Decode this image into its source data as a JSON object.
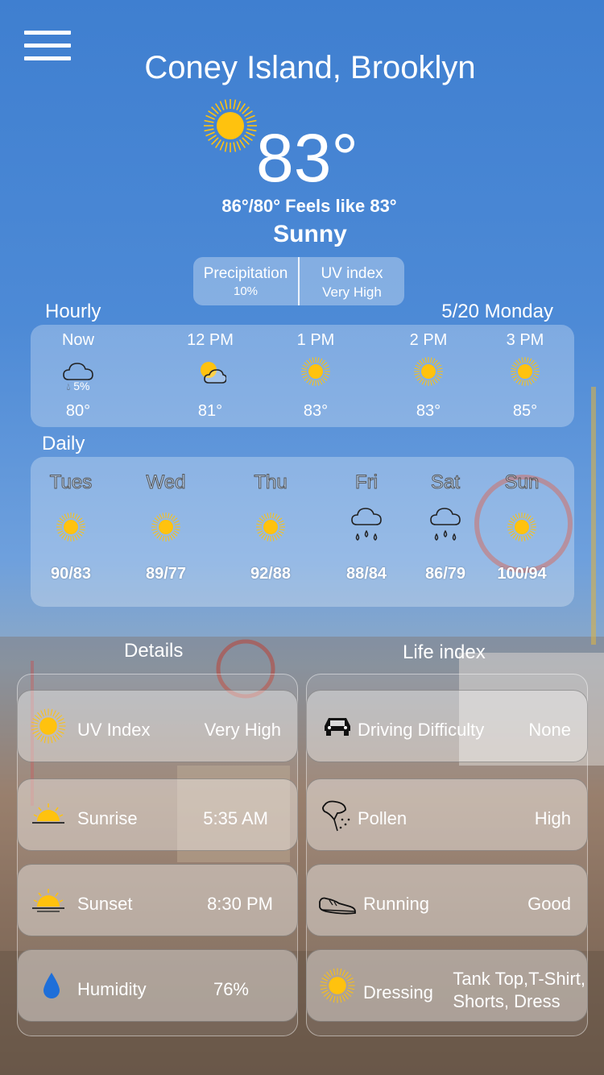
{
  "header": {
    "city": "Coney Island, Brooklyn",
    "temperature": "83°",
    "hi_lo_feels": "86°/80° Feels like 83°",
    "condition": "Sunny",
    "weather_icon": "sun-icon"
  },
  "stats": {
    "precipitation_label": "Precipitation",
    "precipitation_value": "10%",
    "uv_label": "UV index",
    "uv_value": "Very High"
  },
  "hourly": {
    "label": "Hourly",
    "date": "5/20 Monday",
    "items": [
      {
        "time": "Now",
        "icon": "cloud-icon",
        "pop": "5%",
        "temp": "80°"
      },
      {
        "time": "12 PM",
        "icon": "partly-cloudy-icon",
        "pop": "",
        "temp": "81°"
      },
      {
        "time": "1 PM",
        "icon": "sun-icon",
        "pop": "",
        "temp": "83°"
      },
      {
        "time": "2 PM",
        "icon": "sun-icon",
        "pop": "",
        "temp": "83°"
      },
      {
        "time": "3 PM",
        "icon": "sun-icon",
        "pop": "",
        "temp": "85°"
      }
    ]
  },
  "daily": {
    "label": "Daily",
    "items": [
      {
        "day": "Tues",
        "icon": "sun-icon",
        "temps": "90/83"
      },
      {
        "day": "Wed",
        "icon": "sun-icon",
        "temps": "89/77"
      },
      {
        "day": "Thu",
        "icon": "sun-icon",
        "temps": "92/88"
      },
      {
        "day": "Fri",
        "icon": "rain-icon",
        "temps": "88/84"
      },
      {
        "day": "Sat",
        "icon": "rain-icon",
        "temps": "86/79"
      },
      {
        "day": "Sun",
        "icon": "sun-icon",
        "temps": "100/94"
      }
    ]
  },
  "details": {
    "title": "Details",
    "items": [
      {
        "label": "UV Index",
        "value": "Very High",
        "icon": "sun-icon"
      },
      {
        "label": "Sunrise",
        "value": "5:35 AM",
        "icon": "sunrise-icon"
      },
      {
        "label": "Sunset",
        "value": "8:30 PM",
        "icon": "sunset-icon"
      },
      {
        "label": "Humidity",
        "value": "76%",
        "icon": "water-drop-icon"
      }
    ]
  },
  "life_index": {
    "title": "Life index",
    "items": [
      {
        "label": "Driving Difficulty",
        "value": "None",
        "icon": "car-icon"
      },
      {
        "label": "Pollen",
        "value": "High",
        "icon": "pollen-icon"
      },
      {
        "label": "Running",
        "value": "Good",
        "icon": "shoe-icon"
      },
      {
        "label": "Dressing",
        "value_line1": "Tank Top,T-Shirt,",
        "value_line2": "Shorts, Dress",
        "icon": "sun-icon"
      }
    ]
  },
  "colors": {
    "sun": "#ffc20e",
    "sky_blue": "#3f7fd0",
    "drop_blue": "#1e6fd9"
  }
}
